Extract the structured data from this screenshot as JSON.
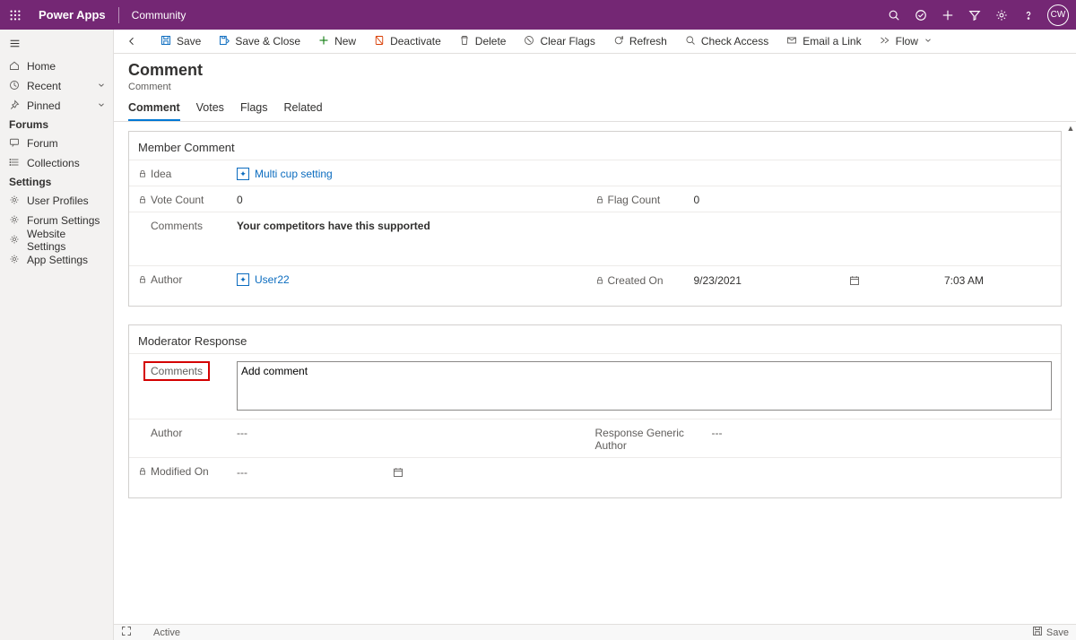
{
  "topbar": {
    "brand": "Power Apps",
    "context": "Community",
    "avatar": "CW"
  },
  "sidebar": {
    "home": "Home",
    "recent": "Recent",
    "pinned": "Pinned",
    "sections": {
      "forums": {
        "title": "Forums",
        "items": [
          "Forum",
          "Collections"
        ]
      },
      "settings": {
        "title": "Settings",
        "items": [
          "User Profiles",
          "Forum Settings",
          "Website Settings",
          "App Settings"
        ]
      }
    }
  },
  "cmdbar": {
    "save": "Save",
    "saveclose": "Save & Close",
    "new": "New",
    "deactivate": "Deactivate",
    "delete": "Delete",
    "clearflags": "Clear Flags",
    "refresh": "Refresh",
    "checkaccess": "Check Access",
    "emaillink": "Email a Link",
    "flow": "Flow"
  },
  "header": {
    "title": "Comment",
    "subtitle": "Comment"
  },
  "tabs": [
    "Comment",
    "Votes",
    "Flags",
    "Related"
  ],
  "member": {
    "section": "Member Comment",
    "labels": {
      "idea": "Idea",
      "votecount": "Vote Count",
      "flagcount": "Flag Count",
      "comments": "Comments",
      "author": "Author",
      "createdon": "Created On"
    },
    "idea": "Multi cup setting",
    "votecount": "0",
    "flagcount": "0",
    "comments": "Your competitors have this supported",
    "author": "User22",
    "created_date": "9/23/2021",
    "created_time": "7:03 AM"
  },
  "moderator": {
    "section": "Moderator Response",
    "labels": {
      "comments": "Comments",
      "author": "Author",
      "responsegeneric": "Response Generic Author",
      "modifiedon": "Modified On"
    },
    "comment_value": "Add comment",
    "author": "---",
    "responsegeneric": "---",
    "modifiedon": "---"
  },
  "footer": {
    "status": "Active",
    "save": "Save"
  }
}
